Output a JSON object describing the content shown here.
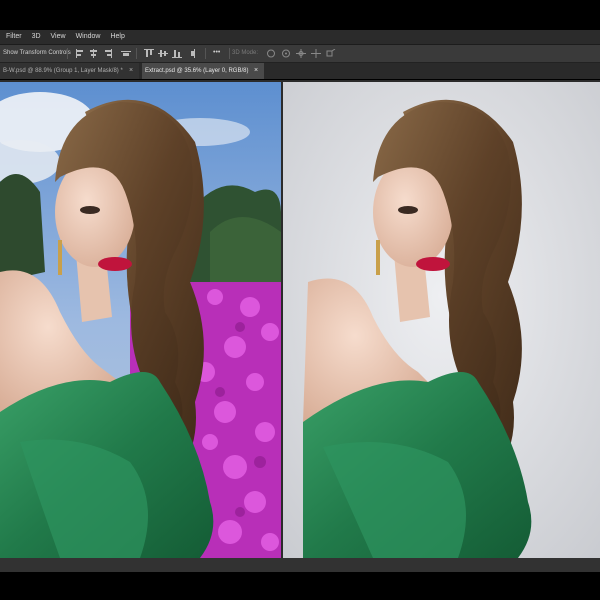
{
  "menu": {
    "items": [
      "Filter",
      "3D",
      "View",
      "Window",
      "Help"
    ]
  },
  "options": {
    "show_transform_label": "Show Transform Controls",
    "more_label": "•••",
    "mode_3d_label": "3D Mode:"
  },
  "tabs": [
    {
      "label": "B-W.psd @ 88.9% (Group 1, Layer Mask/8) *",
      "close": "×",
      "active": false
    },
    {
      "label": "Extract.psd @ 35.6% (Layer 0, RGB/8)",
      "close": "×",
      "active": true
    }
  ],
  "colors": {
    "ui_dark": "#2b2b2b",
    "dress_green": "#2e8b57",
    "flower_magenta": "#c42fbf",
    "sky_blue": "#6f9fd8",
    "studio_grey": "#dcdde1",
    "hair_brown": "#6b4a2c"
  }
}
